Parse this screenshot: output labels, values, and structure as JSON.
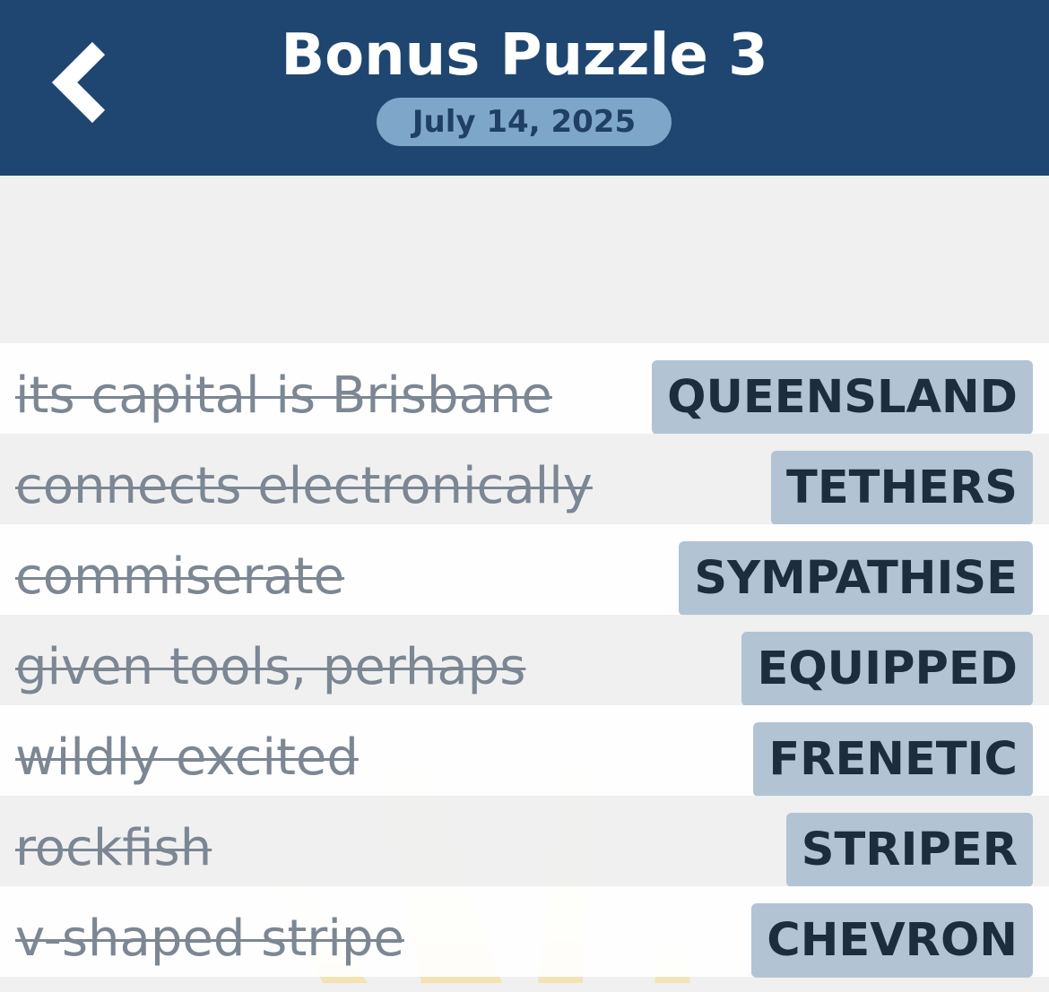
{
  "header": {
    "title": "Bonus Puzzle 3",
    "date": "July 14, 2025",
    "back_icon": "chevron-left-icon",
    "background_color": "#1f4670",
    "pill_color": "#7ea6c8"
  },
  "clues": [
    {
      "clue": "its capital is Brisbane",
      "answer": "QUEENSLAND"
    },
    {
      "clue": "connects electronically",
      "answer": "TETHERS"
    },
    {
      "clue": "commiserate",
      "answer": "SYMPATHISE"
    },
    {
      "clue": "given tools, perhaps",
      "answer": "EQUIPPED"
    },
    {
      "clue": "wildly excited",
      "answer": "FRENETIC"
    },
    {
      "clue": "rockfish",
      "answer": "STRIPER"
    },
    {
      "clue": "v-shaped stripe",
      "answer": "CHEVRON"
    }
  ],
  "colors": {
    "answer_chip": "#b2c4d3",
    "answer_text": "#1c2d40",
    "clue_text_solved": "#7c8793"
  }
}
